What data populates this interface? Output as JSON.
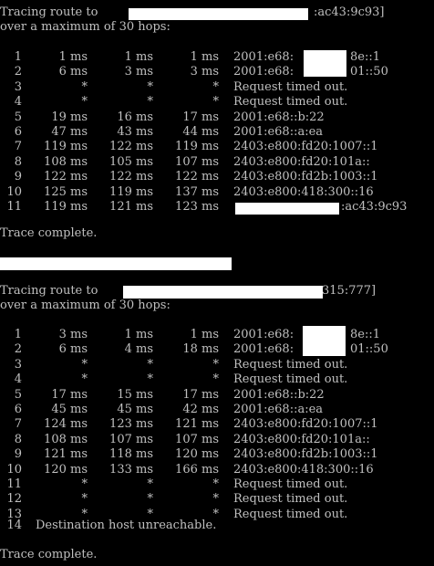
{
  "colors": {
    "background": "#000000",
    "text": "#c0c0c0",
    "redaction": "#ffffff"
  },
  "trace1": {
    "header_prefix": "Tracing route to",
    "header_suffix": ":ac43:9c93]",
    "max_hops": "over a maximum of 30 hops:",
    "hops": [
      {
        "n": "1",
        "t1": "1 ms",
        "t2": "1 ms",
        "t3": "1 ms",
        "addr": "2001:e68:",
        "addr_tail": "8e::1"
      },
      {
        "n": "2",
        "t1": "6 ms",
        "t2": "3 ms",
        "t3": "3 ms",
        "addr": "2001:e68:",
        "addr_tail": "01::50"
      },
      {
        "n": "3",
        "t1": "*",
        "t2": "*",
        "t3": "*",
        "addr": "Request timed out.",
        "addr_tail": ""
      },
      {
        "n": "4",
        "t1": "*",
        "t2": "*",
        "t3": "*",
        "addr": "Request timed out.",
        "addr_tail": ""
      },
      {
        "n": "5",
        "t1": "19 ms",
        "t2": "16 ms",
        "t3": "17 ms",
        "addr": "2001:e68::b:22",
        "addr_tail": ""
      },
      {
        "n": "6",
        "t1": "47 ms",
        "t2": "43 ms",
        "t3": "44 ms",
        "addr": "2001:e68::a:ea",
        "addr_tail": ""
      },
      {
        "n": "7",
        "t1": "119 ms",
        "t2": "122 ms",
        "t3": "119 ms",
        "addr": "2403:e800:fd20:1007::1",
        "addr_tail": ""
      },
      {
        "n": "8",
        "t1": "108 ms",
        "t2": "105 ms",
        "t3": "107 ms",
        "addr": "2403:e800:fd20:101a::",
        "addr_tail": ""
      },
      {
        "n": "9",
        "t1": "122 ms",
        "t2": "122 ms",
        "t3": "122 ms",
        "addr": "2403:e800:fd2b:1003::1",
        "addr_tail": ""
      },
      {
        "n": "10",
        "t1": "125 ms",
        "t2": "119 ms",
        "t3": "137 ms",
        "addr": "2403:e800:418:300::16",
        "addr_tail": ""
      },
      {
        "n": "11",
        "t1": "119 ms",
        "t2": "121 ms",
        "t3": "123 ms",
        "addr": "",
        "addr_tail": ":ac43:9c93"
      }
    ],
    "complete": "Trace complete."
  },
  "trace2": {
    "header_prefix": "Tracing route to",
    "header_suffix": "315:777]",
    "max_hops": "over a maximum of 30 hops:",
    "hops": [
      {
        "n": "1",
        "t1": "3 ms",
        "t2": "1 ms",
        "t3": "1 ms",
        "addr": "2001:e68:",
        "addr_tail": "8e::1"
      },
      {
        "n": "2",
        "t1": "6 ms",
        "t2": "4 ms",
        "t3": "18 ms",
        "addr": "2001:e68:",
        "addr_tail": "01::50"
      },
      {
        "n": "3",
        "t1": "*",
        "t2": "*",
        "t3": "*",
        "addr": "Request timed out.",
        "addr_tail": ""
      },
      {
        "n": "4",
        "t1": "*",
        "t2": "*",
        "t3": "*",
        "addr": "Request timed out.",
        "addr_tail": ""
      },
      {
        "n": "5",
        "t1": "17 ms",
        "t2": "15 ms",
        "t3": "17 ms",
        "addr": "2001:e68::b:22",
        "addr_tail": ""
      },
      {
        "n": "6",
        "t1": "45 ms",
        "t2": "45 ms",
        "t3": "42 ms",
        "addr": "2001:e68::a:ea",
        "addr_tail": ""
      },
      {
        "n": "7",
        "t1": "124 ms",
        "t2": "123 ms",
        "t3": "121 ms",
        "addr": "2403:e800:fd20:1007::1",
        "addr_tail": ""
      },
      {
        "n": "8",
        "t1": "108 ms",
        "t2": "107 ms",
        "t3": "107 ms",
        "addr": "2403:e800:fd20:101a::",
        "addr_tail": ""
      },
      {
        "n": "9",
        "t1": "121 ms",
        "t2": "118 ms",
        "t3": "120 ms",
        "addr": "2403:e800:fd2b:1003::1",
        "addr_tail": ""
      },
      {
        "n": "10",
        "t1": "120 ms",
        "t2": "133 ms",
        "t3": "166 ms",
        "addr": "2403:e800:418:300::16",
        "addr_tail": ""
      },
      {
        "n": "11",
        "t1": "*",
        "t2": "*",
        "t3": "*",
        "addr": "Request timed out.",
        "addr_tail": ""
      },
      {
        "n": "12",
        "t1": "*",
        "t2": "*",
        "t3": "*",
        "addr": "Request timed out.",
        "addr_tail": ""
      },
      {
        "n": "13",
        "t1": "*",
        "t2": "*",
        "t3": "*",
        "addr": "Request timed out.",
        "addr_tail": ""
      }
    ],
    "unreachable_hop": "14",
    "unreachable_text": "Destination host unreachable.",
    "complete": "Trace complete."
  }
}
